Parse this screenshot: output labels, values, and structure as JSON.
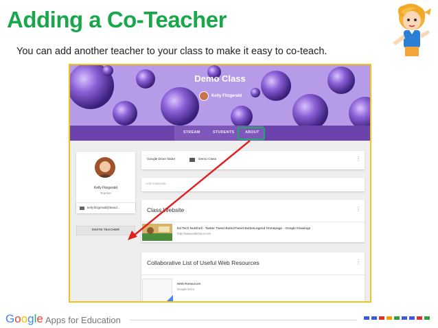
{
  "slide": {
    "title": "Adding a Co-Teacher",
    "subtitle": "You can add another teacher to your class to make it easy to co-teach."
  },
  "classroom": {
    "class_name": "Demo Class",
    "teacher_name": "Kelly Fitzgerald",
    "tabs": [
      {
        "label": "STREAM"
      },
      {
        "label": "STUDENTS"
      },
      {
        "label": "ABOUT"
      }
    ],
    "profile": {
      "name": "Kelly Fitzgerald",
      "role": "Teacher",
      "email": "kelly.fitzgerald@leand...",
      "invite_button": "INVITE TEACHER"
    },
    "drive": {
      "label": "Google Drive folder",
      "folder_name": "Demo Class"
    },
    "add_materials_placeholder": "Add materials...",
    "website_card": {
      "heading": "Class Website",
      "link_title": "Ed Tech NutShell - Twitter Tweet ButtonTweet ButtonLegend Homepage - Google Drawings",
      "link_url": "http://www.edtechnut.com"
    },
    "resources_card": {
      "heading": "Collaborative List of Useful Web Resources",
      "doc_title": "Web Resources",
      "doc_type": "Google Docs"
    }
  },
  "footer": {
    "google_letters": [
      "G",
      "o",
      "o",
      "g",
      "l",
      "e"
    ],
    "google_colors": [
      "#4285f4",
      "#ea4335",
      "#fbbc05",
      "#4285f4",
      "#34a853",
      "#ea4335"
    ],
    "product": "Apps for Education",
    "square_colors": [
      "#3b5bdb",
      "#3b5bdb",
      "#e03131",
      "#f59f00",
      "#2f9e44",
      "#3b5bdb",
      "#3b5bdb",
      "#e03131",
      "#2f9e44"
    ]
  },
  "colors": {
    "title_green": "#1aa64a",
    "banner_purple": "#6c43ad",
    "highlight_green": "#22a86f",
    "arrow_red": "#e02020",
    "frame_yellow": "#f2c21b"
  }
}
